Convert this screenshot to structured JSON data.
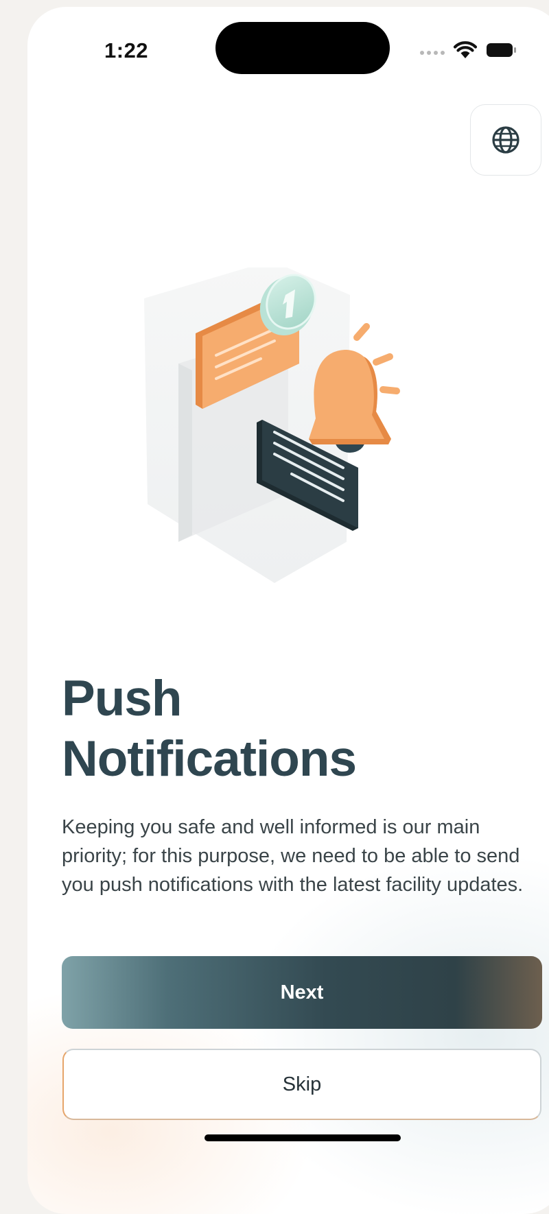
{
  "status_bar": {
    "time": "1:22"
  },
  "header": {
    "language_icon": "globe-icon"
  },
  "onboarding": {
    "title_line1": "Push",
    "title_line2": "Notifications",
    "description": "Keeping you safe and well informed is our main priority; for this purpose, we need to be able to send you push notifications with the latest facility updates.",
    "illustration": "notification-bell-illustration"
  },
  "actions": {
    "next_label": "Next",
    "skip_label": "Skip"
  },
  "colors": {
    "title": "#2f4650",
    "accent_orange": "#f4a868",
    "dark_teal": "#2b3d44"
  }
}
